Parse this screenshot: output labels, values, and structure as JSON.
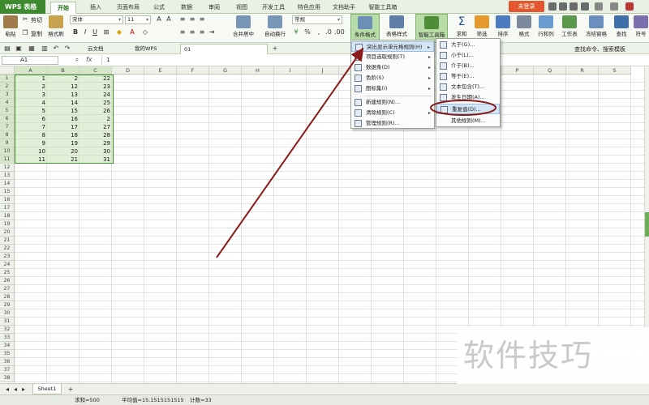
{
  "app": {
    "logo": "WPS 表格",
    "login": "未登录"
  },
  "menu_tabs": [
    "开始",
    "插入",
    "页面布局",
    "公式",
    "数据",
    "审阅",
    "视图",
    "开发工具",
    "特色应用",
    "文档助手",
    "智能工具箱"
  ],
  "ribbon": {
    "paste": "粘贴",
    "cut": "剪切",
    "copy": "复制",
    "format_painter": "格式刷",
    "font_name": "宋体",
    "font_size": "11",
    "bold": "B",
    "italic": "I",
    "underline": "U",
    "merge_center": "合并居中",
    "wrap": "自动换行",
    "number_format": "常规",
    "percent": "%",
    "cond_format": "条件格式",
    "table_style": "表格样式",
    "smart_toolbox": "智能工具箱",
    "sum": "求和",
    "filter": "筛选",
    "sort": "排序",
    "format": "格式",
    "row_col": "行和列",
    "worksheet": "工作表",
    "freeze": "冻结窗格",
    "find": "查找",
    "symbol": "符号"
  },
  "doc_tabs": {
    "cloud": "云文档",
    "mywps": "我的WPS",
    "file": "01",
    "search": "查找命令、搜索模板"
  },
  "formula_bar": {
    "cell": "A1",
    "fx": "fx",
    "value": "1"
  },
  "columns": [
    "A",
    "B",
    "C",
    "D",
    "E",
    "F",
    "G",
    "H",
    "I",
    "J",
    "K",
    "L",
    "M",
    "N",
    "O",
    "P",
    "Q",
    "R",
    "S"
  ],
  "rows": [
    1,
    2,
    3,
    4,
    5,
    6,
    7,
    8,
    9,
    10,
    11,
    12,
    13,
    14,
    15,
    16,
    17,
    18,
    19,
    20,
    21,
    22,
    23,
    24,
    25,
    26,
    27,
    28,
    29,
    30,
    31,
    32,
    33,
    34,
    35,
    36,
    37,
    38
  ],
  "cells": [
    [
      1,
      2,
      22
    ],
    [
      2,
      12,
      23
    ],
    [
      3,
      13,
      24
    ],
    [
      4,
      14,
      25
    ],
    [
      5,
      15,
      26
    ],
    [
      6,
      16,
      2
    ],
    [
      7,
      17,
      27
    ],
    [
      8,
      18,
      28
    ],
    [
      9,
      19,
      29
    ],
    [
      10,
      20,
      30
    ],
    [
      11,
      21,
      31
    ]
  ],
  "cond_menu": [
    {
      "label": "突出显示单元格规则(H)",
      "arrow": "▸"
    },
    {
      "label": "项目选取规则(T)",
      "arrow": "▸"
    },
    {
      "label": "数据条(D)",
      "arrow": "▸"
    },
    {
      "label": "色阶(S)",
      "arrow": "▸"
    },
    {
      "label": "图标集(I)",
      "arrow": "▸"
    },
    {
      "label": "新建规则(N)...",
      "arrow": ""
    },
    {
      "label": "清除规则(C)",
      "arrow": "▸"
    },
    {
      "label": "管理规则(R)...",
      "arrow": ""
    }
  ],
  "highlight_menu": [
    "大于(G)...",
    "小于(L)...",
    "介于(B)...",
    "等于(E)...",
    "文本包含(T)...",
    "发生日期(A)...",
    "重复值(D)...",
    "其他规则(M)..."
  ],
  "sheet": {
    "name": "Sheet1",
    "add": "+"
  },
  "status": {
    "sum": "求和=500",
    "avg": "平均值=15.1515151515",
    "count": "计数=33"
  },
  "watermark": "软件技巧",
  "colors": {
    "accent": "#3d8a2f",
    "arrow": "#8b1a1a",
    "login": "#e2572e"
  }
}
